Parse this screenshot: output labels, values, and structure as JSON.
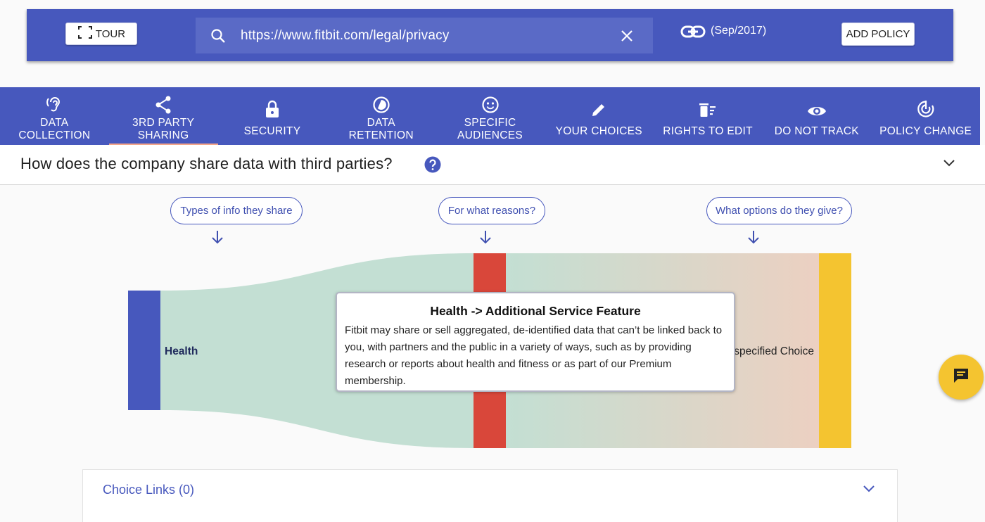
{
  "topbar": {
    "tour_label": "Tour",
    "search_value": "https://www.fitbit.com/legal/privacy",
    "policy_date": "(Sep/2017)",
    "add_policy_label": "Add policy",
    "icons": [
      "focus-frame-icon",
      "search-icon",
      "close-icon",
      "link-icon"
    ]
  },
  "nav": {
    "tabs": [
      {
        "label": "Data\nCollection",
        "icon": "ear-icon"
      },
      {
        "label": "3rd Party\nSharing",
        "icon": "share-icon",
        "active": true
      },
      {
        "label": "Security",
        "icon": "lock-icon"
      },
      {
        "label": "Data\nRetention",
        "icon": "timelapse-icon"
      },
      {
        "label": "Specific\nAudiences",
        "icon": "face-icon"
      },
      {
        "label": "Your Choices",
        "icon": "pencil-icon"
      },
      {
        "label": "Rights to Edit",
        "icon": "delete-sweep-icon"
      },
      {
        "label": "Do Not Track",
        "icon": "eye-icon"
      },
      {
        "label": "Policy Change",
        "icon": "target-icon"
      }
    ]
  },
  "question": {
    "title": "How does the company share data with third parties?",
    "help_icon": "help-icon"
  },
  "sankey": {
    "columns": [
      {
        "header": "Types of info they share"
      },
      {
        "header": "For what reasons?"
      },
      {
        "header": "What options do they give?"
      }
    ],
    "nodes": {
      "info": {
        "label": "Health",
        "color": "#4758bd"
      },
      "reason": {
        "label": "Additional Service Feature",
        "color": "#d9473a"
      },
      "choice": {
        "label": "Unspecified Choice",
        "visible_label": "specified Choice",
        "color": "#f4c430"
      }
    },
    "links": [
      {
        "from": "Health",
        "to": "Additional Service Feature",
        "color": "#c3dfd3"
      },
      {
        "from": "Additional Service Feature",
        "to": "Unspecified Choice",
        "color_start": "#c3dfd3",
        "color_end": "#ecd0c1"
      }
    ]
  },
  "tooltip": {
    "title": "Health -> Additional Service Feature",
    "body": "Fitbit may share or sell aggregated, de-identified data that can’t be linked back to you, with partners and the public in a variety of ways, such as by providing research or reports about health and fitness or as part of our Premium membership."
  },
  "choice_links": {
    "label": "Choice Links (0)"
  },
  "colors": {
    "primary": "#4758bd",
    "accent_yellow": "#f4c430",
    "accent_red": "#d9473a",
    "active_tab_underline": "#f4a58a"
  }
}
